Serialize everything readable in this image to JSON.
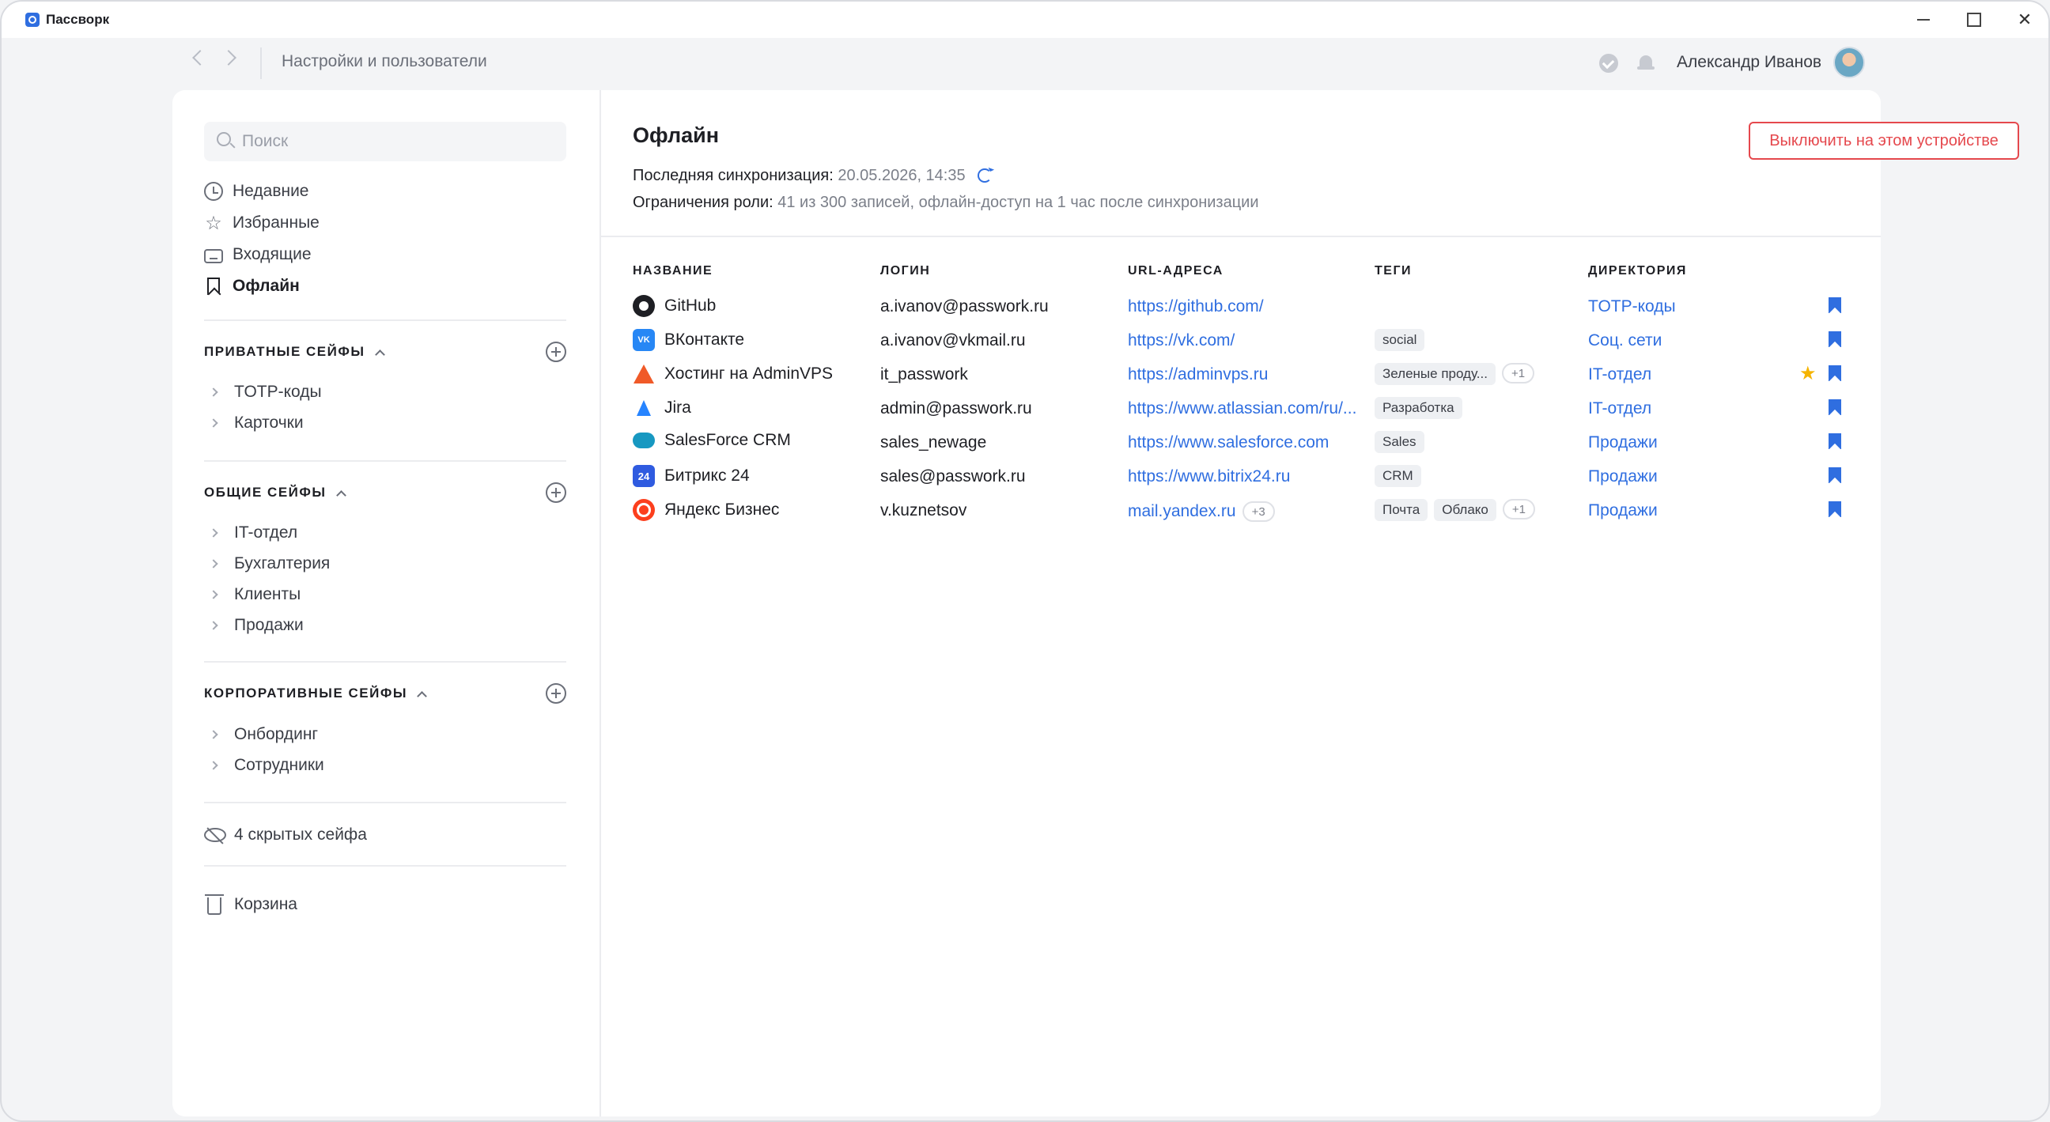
{
  "window": {
    "title": "Пассворк"
  },
  "topbar": {
    "breadcrumb": "Настройки и пользователи",
    "user_name": "Александр Иванов"
  },
  "sidebar": {
    "search_placeholder": "Поиск",
    "nav": [
      {
        "label": "Недавние",
        "icon": "clock-icon"
      },
      {
        "label": "Избранные",
        "icon": "star-icon"
      },
      {
        "label": "Входящие",
        "icon": "inbox-icon"
      },
      {
        "label": "Офлайн",
        "icon": "bookmark-icon",
        "active": true
      }
    ],
    "private": {
      "title": "ПРИВАТНЫЕ СЕЙФЫ",
      "items": [
        "TOTP-коды",
        "Карточки"
      ]
    },
    "shared": {
      "title": "ОБЩИЕ СЕЙФЫ",
      "items": [
        "IT-отдел",
        "Бухгалтерия",
        "Клиенты",
        "Продажи"
      ]
    },
    "corporate": {
      "title": "КОРПОРАТИВНЫЕ СЕЙФЫ",
      "items": [
        "Онбординг",
        "Сотрудники"
      ]
    },
    "hidden_label": "4 скрытых сейфа",
    "trash_label": "Корзина"
  },
  "content": {
    "title": "Офлайн",
    "sync_label": "Последняя синхронизация:",
    "sync_value": "20.05.2026, 14:35",
    "role_label": "Ограничения роли:",
    "role_value": "41 из 300 записей, офлайн-доступ на 1 час после синхронизации",
    "disable_button": "Выключить на этом устройстве",
    "columns": {
      "name": "НАЗВАНИЕ",
      "login": "ЛОГИН",
      "url": "URL-АДРЕСА",
      "tags": "ТЕГИ",
      "dir": "ДИРЕКТОРИЯ"
    },
    "rows": [
      {
        "name": "GitHub",
        "login": "a.ivanov@passwork.ru",
        "url": "https://github.com/",
        "url_more": "",
        "tags": [],
        "tags_more": "",
        "dir": "TOTP-коды",
        "starred": false
      },
      {
        "name": "ВКонтакте",
        "login": "a.ivanov@vkmail.ru",
        "url": "https://vk.com/",
        "url_more": "",
        "tags": [
          "social"
        ],
        "tags_more": "",
        "dir": "Соц. сети",
        "starred": false
      },
      {
        "name": "Хостинг на AdminVPS",
        "login": "it_passwork",
        "url": "https://adminvps.ru",
        "url_more": "",
        "tags": [
          "Зеленые проду..."
        ],
        "tags_more": "+1",
        "dir": "IT-отдел",
        "starred": true
      },
      {
        "name": "Jira",
        "login": "admin@passwork.ru",
        "url": "https://www.atlassian.com/ru/...",
        "url_more": "",
        "tags": [
          "Разработка"
        ],
        "tags_more": "",
        "dir": "IT-отдел",
        "starred": false
      },
      {
        "name": "SalesForce CRM",
        "login": "sales_newage",
        "url": "https://www.salesforce.com",
        "url_more": "",
        "tags": [
          "Sales"
        ],
        "tags_more": "",
        "dir": "Продажи",
        "starred": false
      },
      {
        "name": "Битрикс 24",
        "login": "sales@passwork.ru",
        "url": "https://www.bitrix24.ru",
        "url_more": "",
        "tags": [
          "CRM"
        ],
        "tags_more": "",
        "dir": "Продажи",
        "starred": false
      },
      {
        "name": "Яндекс Бизнес",
        "login": "v.kuznetsov",
        "url": "mail.yandex.ru",
        "url_more": "+3",
        "tags": [
          "Почта",
          "Облако"
        ],
        "tags_more": "+1",
        "dir": "Продажи",
        "starred": false
      }
    ]
  }
}
